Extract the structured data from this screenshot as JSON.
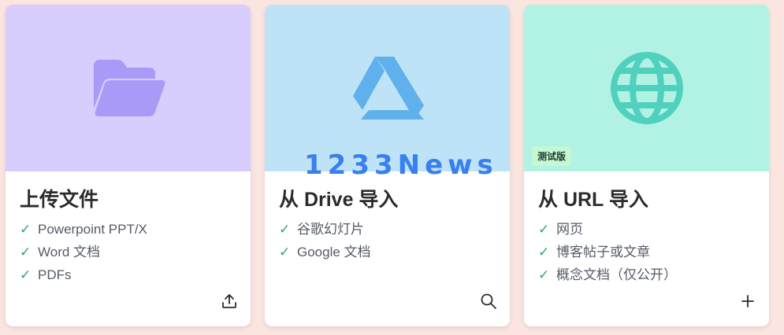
{
  "cards": [
    {
      "title": "上传文件",
      "features": [
        "Powerpoint PPT/X",
        "Word 文档",
        "PDFs"
      ],
      "action_icon": "upload-icon",
      "hero_color": "#d8cdfd",
      "icon": "folder-icon"
    },
    {
      "title": "从 Drive 导入",
      "features": [
        "谷歌幻灯片",
        "Google 文档"
      ],
      "action_icon": "search-icon",
      "hero_color": "#bee3f7",
      "icon": "google-drive-icon"
    },
    {
      "title": "从 URL 导入",
      "badge": "测试版",
      "features": [
        "网页",
        "博客帖子或文章",
        "概念文档（仅公开）"
      ],
      "action_icon": "plus-icon",
      "hero_color": "#b2f2e5",
      "icon": "globe-icon"
    }
  ],
  "watermark": "1233News",
  "colors": {
    "check": "#2ca764",
    "background": "#fbe5e0"
  }
}
